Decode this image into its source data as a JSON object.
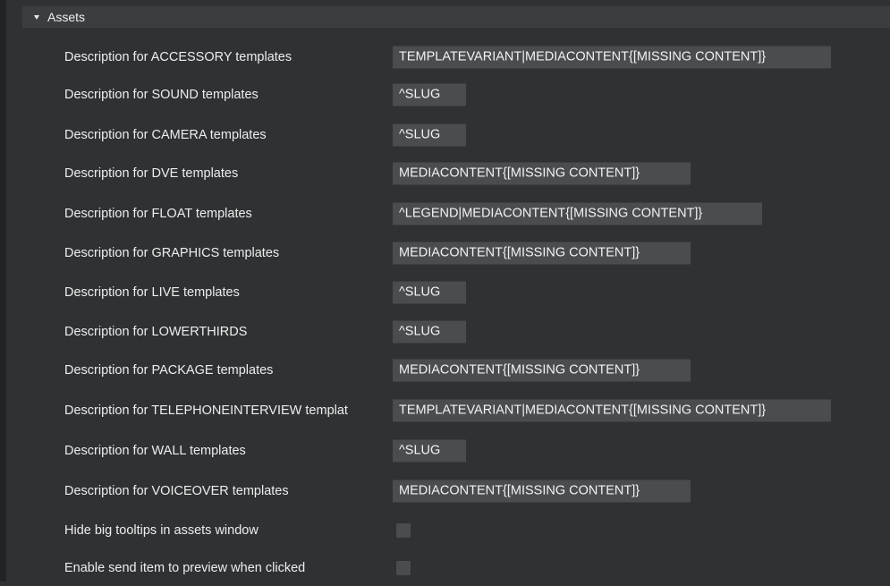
{
  "section": {
    "title": "Assets",
    "expanded": true
  },
  "rows": [
    {
      "label": "Description for ACCESSORY templates",
      "value": "TEMPLATEVARIANT|MEDIACONTENT{[MISSING CONTENT]}"
    },
    {
      "label": "Description for SOUND templates",
      "value": "^SLUG"
    },
    {
      "label": "Description for CAMERA templates",
      "value": "^SLUG"
    },
    {
      "label": "Description for DVE templates",
      "value": "MEDIACONTENT{[MISSING CONTENT]}"
    },
    {
      "label": "Description for FLOAT templates",
      "value": "^LEGEND|MEDIACONTENT{[MISSING CONTENT]}"
    },
    {
      "label": "Description for GRAPHICS templates",
      "value": "MEDIACONTENT{[MISSING CONTENT]}"
    },
    {
      "label": "Description for LIVE templates",
      "value": "^SLUG"
    },
    {
      "label": "Description for LOWERTHIRDS",
      "value": "^SLUG"
    },
    {
      "label": "Description for PACKAGE templates",
      "value": "MEDIACONTENT{[MISSING CONTENT]}"
    },
    {
      "label": "Description for TELEPHONEINTERVIEW templat",
      "value": "TEMPLATEVARIANT|MEDIACONTENT{[MISSING CONTENT]}"
    },
    {
      "label": "Description for WALL templates",
      "value": "^SLUG"
    },
    {
      "label": "Description for VOICEOVER templates",
      "value": "MEDIACONTENT{[MISSING CONTENT]}"
    }
  ],
  "checkboxes": [
    {
      "label": "Hide big tooltips in assets window",
      "checked": false
    },
    {
      "label": "Enable send item to preview when clicked",
      "checked": false
    }
  ]
}
